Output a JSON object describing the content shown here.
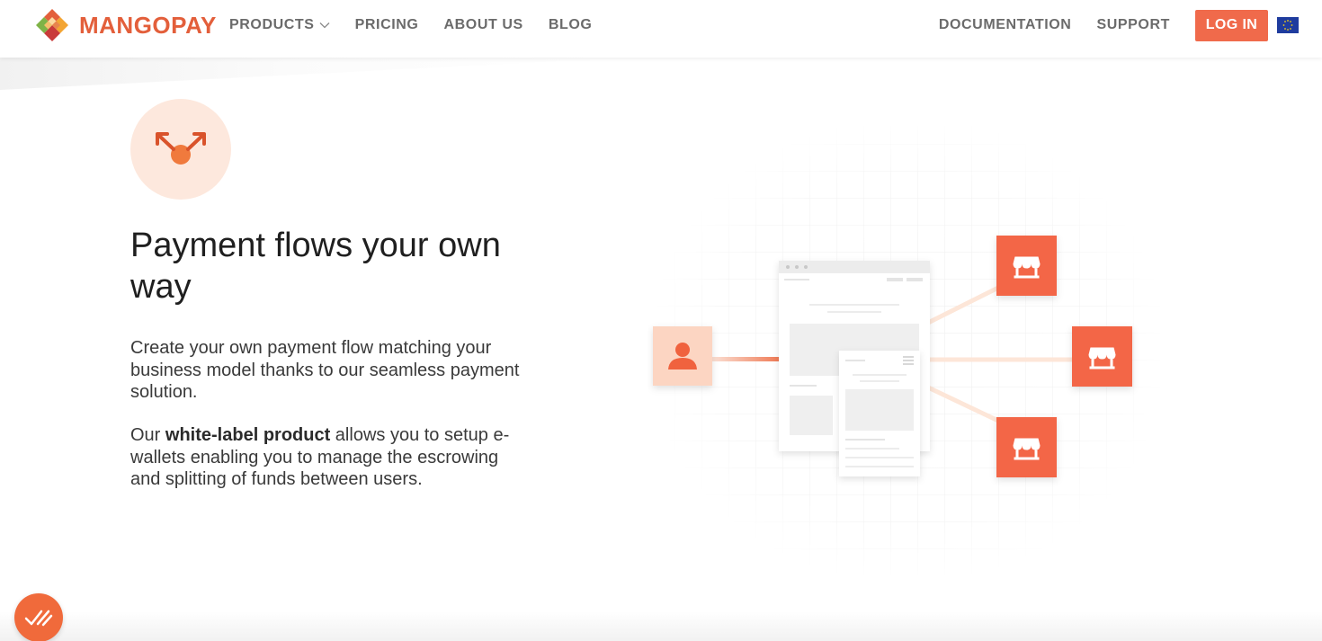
{
  "brand": {
    "name": "MANGOPAY",
    "accent_color": "#e35f3b",
    "button_color": "#f06a4b"
  },
  "nav": {
    "left": [
      {
        "label": "PRODUCTS",
        "has_dropdown": true
      },
      {
        "label": "PRICING"
      },
      {
        "label": "ABOUT US"
      },
      {
        "label": "BLOG"
      }
    ],
    "right": [
      {
        "label": "DOCUMENTATION"
      },
      {
        "label": "SUPPORT"
      }
    ],
    "login_label": "LOG IN",
    "language_flag_icon": "eu-flag-icon"
  },
  "hero": {
    "icon": "split-arrows-icon",
    "headline": "Payment flows your own way",
    "paragraph1": "Create your own payment flow matching your business model thanks to our seamless payment solution.",
    "paragraph2_prefix": "Our ",
    "paragraph2_bold": "white-label product",
    "paragraph2_suffix": " allows you to setup e-wallets enabling you to manage the escrowing and splitting of funds between users."
  },
  "illustration": {
    "user_icon": "user-icon",
    "shop_icon": "shop-icon",
    "shop_count": 3
  },
  "widget": {
    "icon": "checkmarks-icon"
  }
}
